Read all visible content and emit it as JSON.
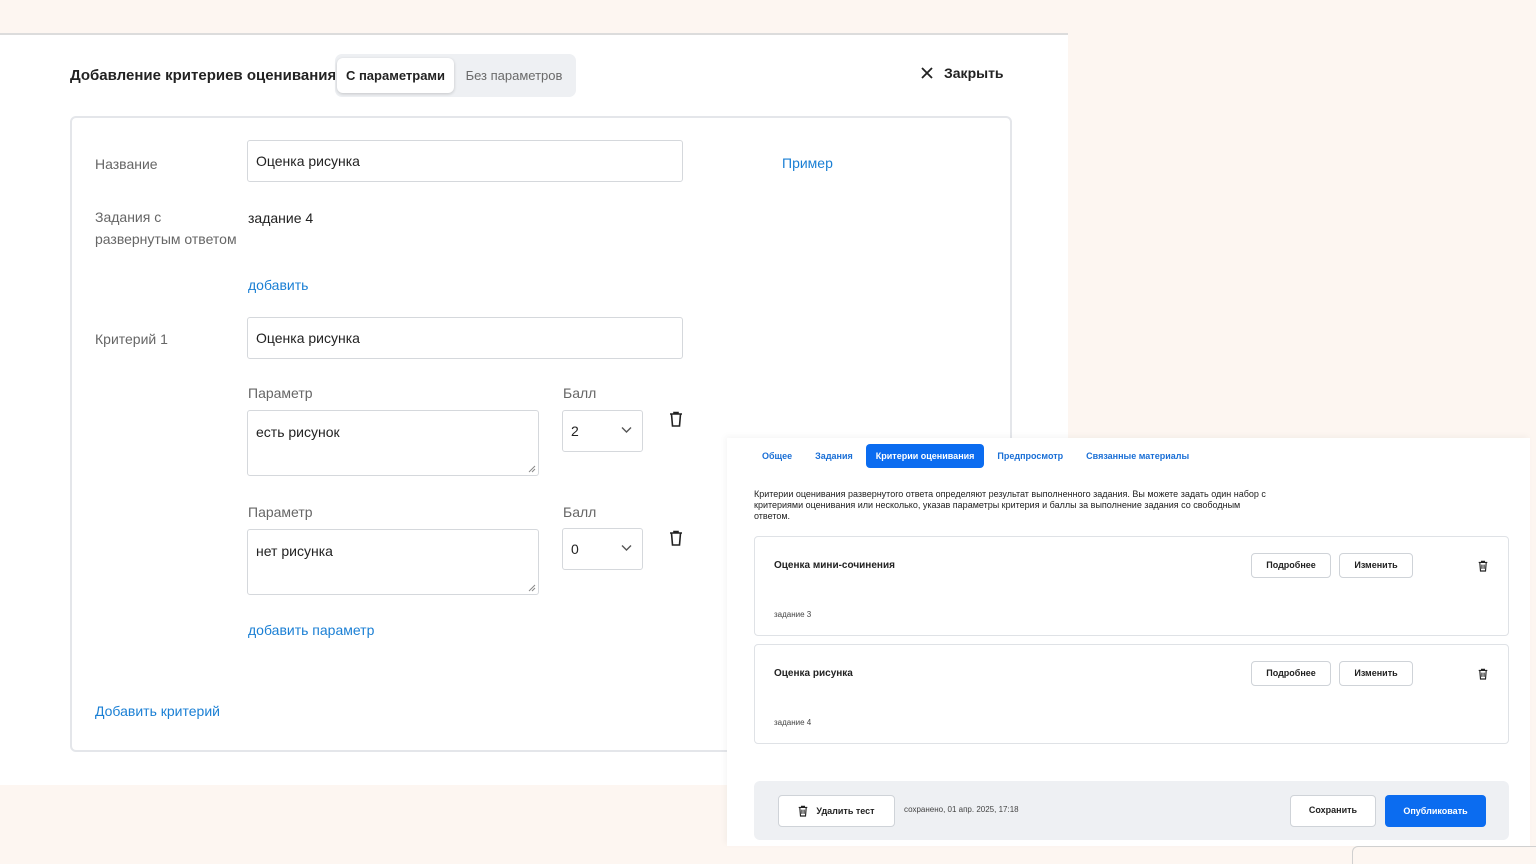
{
  "modal": {
    "title": "Добавление критериев оценивания",
    "segments": [
      "С параметрами",
      "Без параметров"
    ],
    "close_label": "Закрыть",
    "name_label": "Название",
    "name_value": "Оценка рисунка",
    "example_link": "Пример",
    "tasks_label_line1": "Задания с",
    "tasks_label_line2": "развернутым ответом",
    "tasks_value": "задание 4",
    "add_link": "добавить",
    "criterion_label": "Критерий 1",
    "criterion_value": "Оценка рисунка",
    "params": [
      {
        "label": "Параметр",
        "value": "есть рисунок",
        "score_label": "Балл",
        "score": "2"
      },
      {
        "label": "Параметр",
        "value": "нет рисунка",
        "score_label": "Балл",
        "score": "0"
      }
    ],
    "add_param_link": "добавить параметр",
    "add_criterion_link": "Добавить критерий"
  },
  "editor": {
    "tabs": [
      {
        "label": "Общее",
        "active": false
      },
      {
        "label": "Задания",
        "active": false
      },
      {
        "label": "Критерии оценивания",
        "active": true
      },
      {
        "label": "Предпросмотр",
        "active": false
      },
      {
        "label": "Связанные материалы",
        "active": false
      }
    ],
    "description": "Критерии оценивания развернутого ответа определяют результат выполненного задания. Вы можете задать один набор с критериями оценивания или несколько, указав параметры критерия и баллы за выполнение задания со свободным ответом.",
    "criteria": [
      {
        "title": "Оценка мини-сочинения",
        "task": "задание 3",
        "details": "Подробнее",
        "edit": "Изменить"
      },
      {
        "title": "Оценка рисунка",
        "task": "задание 4",
        "details": "Подробнее",
        "edit": "Изменить"
      }
    ],
    "delete_test": "Удалить тест",
    "saved_text": "сохранено, 01 апр. 2025, 17:18",
    "save": "Сохранить",
    "publish": "Опубликовать"
  },
  "colors": {
    "accent": "#0b6cf0",
    "link": "#1a7fd4",
    "background": "#fdf6f1"
  }
}
